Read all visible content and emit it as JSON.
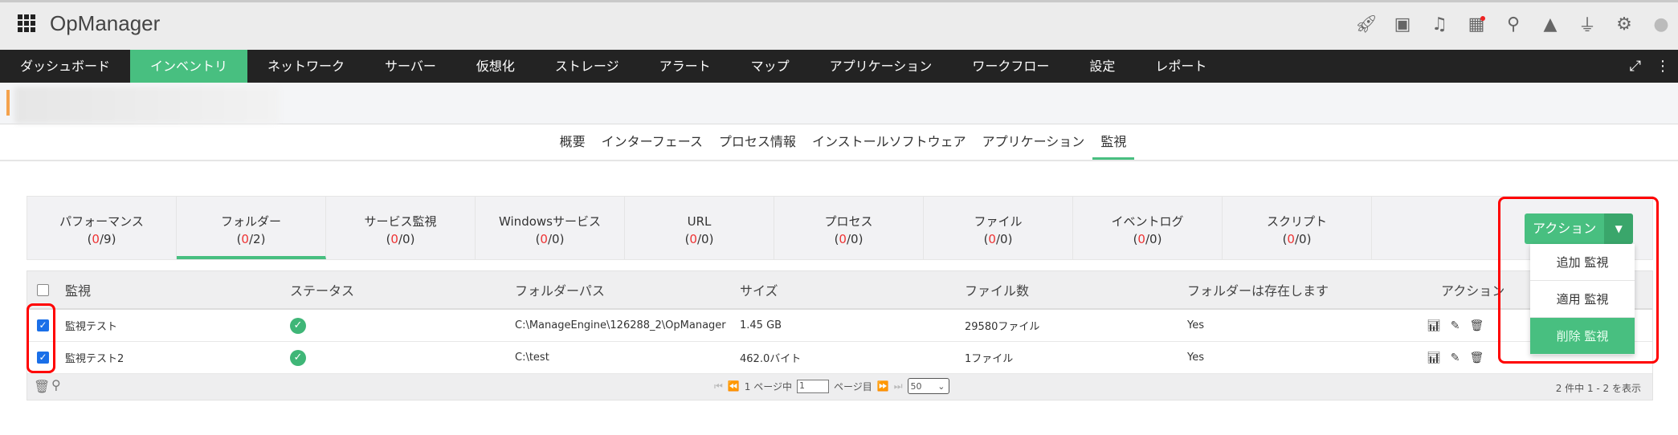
{
  "app": {
    "title": "OpManager"
  },
  "nav": [
    "ダッシュボード",
    "インベントリ",
    "ネットワーク",
    "サーバー",
    "仮想化",
    "ストレージ",
    "アラート",
    "マップ",
    "アプリケーション",
    "ワークフロー",
    "設定",
    "レポート"
  ],
  "subtabs": [
    "概要",
    "インターフェース",
    "プロセス情報",
    "インストールソフトウェア",
    "アプリケーション",
    "監視"
  ],
  "monitor_tabs": [
    {
      "label": "パフォーマンス",
      "down": "0",
      "total": "9"
    },
    {
      "label": "フォルダー",
      "down": "0",
      "total": "2"
    },
    {
      "label": "サービス監視",
      "down": "0",
      "total": "0"
    },
    {
      "label": "Windowsサービス",
      "down": "0",
      "total": "0"
    },
    {
      "label": "URL",
      "down": "0",
      "total": "0"
    },
    {
      "label": "プロセス",
      "down": "0",
      "total": "0"
    },
    {
      "label": "ファイル",
      "down": "0",
      "total": "0"
    },
    {
      "label": "イベントログ",
      "down": "0",
      "total": "0"
    },
    {
      "label": "スクリプト",
      "down": "0",
      "total": "0"
    }
  ],
  "action": {
    "label": "アクション",
    "menu": [
      "追加 監視",
      "適用 監視",
      "削除 監視"
    ]
  },
  "table": {
    "headers": [
      "監視",
      "ステータス",
      "フォルダーパス",
      "サイズ",
      "ファイル数",
      "フォルダーは存在します",
      "アクション"
    ],
    "rows": [
      {
        "name": "監視テスト",
        "path": "C:\\ManageEngine\\126288_2\\OpManager",
        "size": "1.45 GB",
        "files": "29580ファイル",
        "exists": "Yes"
      },
      {
        "name": "監視テスト2",
        "path": "C:\\test",
        "size": "462.0バイト",
        "files": "1ファイル",
        "exists": "Yes"
      }
    ]
  },
  "pager": {
    "page_prefix": "1 ページ中",
    "page_value": "1",
    "page_suffix": "ページ目",
    "page_size": "50",
    "summary": "2 件中 1 - 2 を表示"
  },
  "colors": {
    "accent": "#48bf80",
    "highlight": "#ff0000"
  }
}
